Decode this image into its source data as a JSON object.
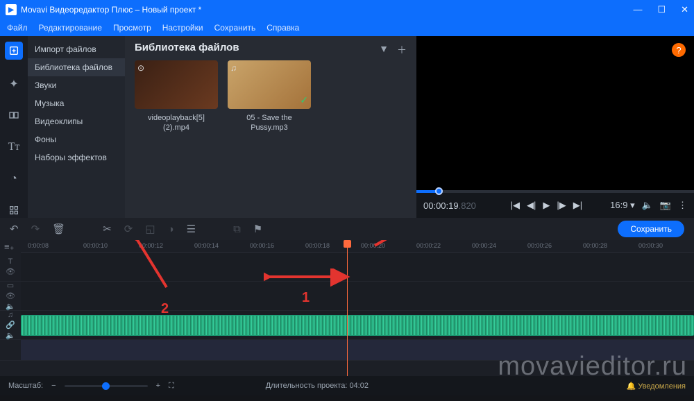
{
  "titlebar": {
    "text": "Movavi Видеоредактор Плюс – Новый проект *"
  },
  "menu": [
    "Файл",
    "Редактирование",
    "Просмотр",
    "Настройки",
    "Сохранить",
    "Справка"
  ],
  "sidebar": {
    "items": [
      "Импорт файлов",
      "Библиотека файлов",
      "Звуки",
      "Музыка",
      "Видеоклипы",
      "Фоны",
      "Наборы эффектов"
    ],
    "selected": 1
  },
  "library": {
    "title": "Библиотека файлов",
    "files": [
      {
        "name": "videoplayback[5] (2).mp4",
        "type": "video"
      },
      {
        "name": "05 - Save the Pussy.mp3",
        "type": "audio",
        "checked": true
      }
    ]
  },
  "preview": {
    "timecode": "00:00:19",
    "timecode_ms": ".820",
    "ratio": "16:9"
  },
  "toolbar": {
    "save": "Сохранить"
  },
  "ruler": [
    "0:00:08",
    "00:00:10",
    "00:00:12",
    "00:00:14",
    "00:00:16",
    "00:00:18",
    "00:00:20",
    "00:00:22",
    "00:00:24",
    "00:00:26",
    "00:00:28",
    "00:00:30"
  ],
  "zoom": {
    "label": "Масштаб:",
    "duration": "Длительность проекта: 04:02",
    "notif": "Уведомления"
  },
  "annotations": {
    "one": "1",
    "two": "2"
  },
  "watermark": "movavieditor.ru"
}
